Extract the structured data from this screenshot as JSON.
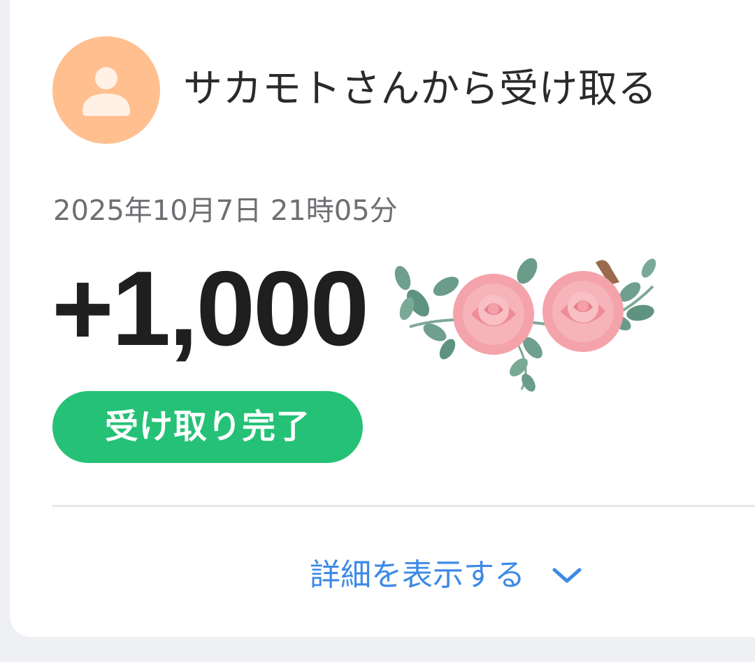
{
  "sender": {
    "title": "サカモトさんから受け取る",
    "avatar_icon": "person-icon",
    "avatar_bg": "#ffbf8f"
  },
  "transaction": {
    "datetime": "2025年10月7日 21時05分",
    "amount": "+1,000",
    "decoration": "rose-flower-sticker"
  },
  "status": {
    "label": "受け取り完了",
    "color": "#25c176"
  },
  "details_toggle": {
    "label": "詳細を表示する",
    "icon": "chevron-down-icon",
    "color": "#3d8ae6"
  }
}
